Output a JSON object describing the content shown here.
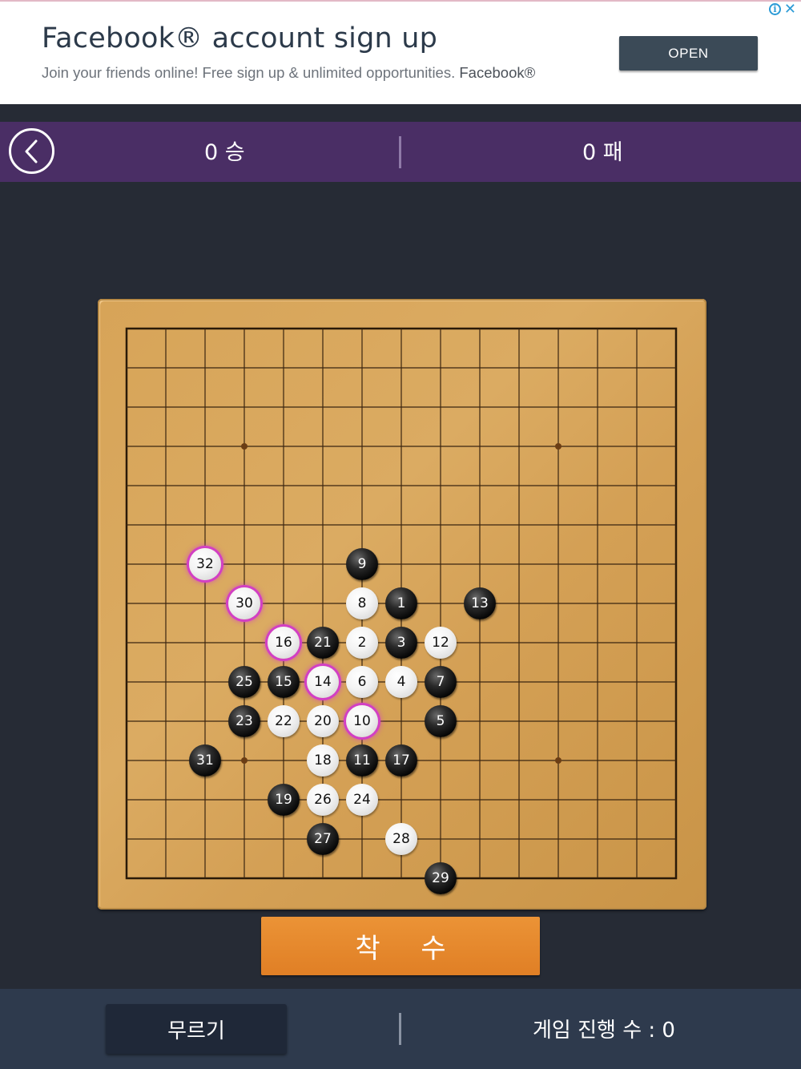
{
  "ad": {
    "title": "Facebook® account sign up",
    "subtitle": "Join your friends online! Free sign up & unlimited opportunities.",
    "brand": "Facebook®",
    "open_label": "OPEN",
    "info_icon": "info-icon",
    "close_icon": "close-icon",
    "accent_color": "#2a9ad6"
  },
  "scorebar": {
    "wins": "0 승",
    "losses": "0 패",
    "back_icon": "chevron-left-icon",
    "color": "#4a2e65"
  },
  "board": {
    "size": 15,
    "star_points": [
      [
        3,
        3
      ],
      [
        11,
        3
      ],
      [
        3,
        11
      ],
      [
        11,
        11
      ]
    ],
    "stones": [
      {
        "n": "1",
        "c": "black",
        "col": 7,
        "row": 7
      },
      {
        "n": "2",
        "c": "white",
        "col": 6,
        "row": 8
      },
      {
        "n": "3",
        "c": "black",
        "col": 7,
        "row": 8
      },
      {
        "n": "4",
        "c": "white",
        "col": 7,
        "row": 9
      },
      {
        "n": "5",
        "c": "black",
        "col": 8,
        "row": 10
      },
      {
        "n": "6",
        "c": "white",
        "col": 6,
        "row": 9
      },
      {
        "n": "7",
        "c": "black",
        "col": 8,
        "row": 9
      },
      {
        "n": "8",
        "c": "white",
        "col": 6,
        "row": 7
      },
      {
        "n": "9",
        "c": "black",
        "col": 6,
        "row": 6
      },
      {
        "n": "10",
        "c": "white",
        "col": 6,
        "row": 10,
        "mark": true
      },
      {
        "n": "11",
        "c": "black",
        "col": 6,
        "row": 11
      },
      {
        "n": "12",
        "c": "white",
        "col": 8,
        "row": 8
      },
      {
        "n": "13",
        "c": "black",
        "col": 9,
        "row": 7
      },
      {
        "n": "14",
        "c": "white",
        "col": 5,
        "row": 9,
        "mark": true
      },
      {
        "n": "15",
        "c": "black",
        "col": 4,
        "row": 9
      },
      {
        "n": "16",
        "c": "white",
        "col": 4,
        "row": 8,
        "mark": true
      },
      {
        "n": "17",
        "c": "black",
        "col": 7,
        "row": 11
      },
      {
        "n": "18",
        "c": "white",
        "col": 5,
        "row": 11
      },
      {
        "n": "19",
        "c": "black",
        "col": 4,
        "row": 12
      },
      {
        "n": "20",
        "c": "white",
        "col": 5,
        "row": 10
      },
      {
        "n": "21",
        "c": "black",
        "col": 5,
        "row": 8
      },
      {
        "n": "22",
        "c": "white",
        "col": 4,
        "row": 10
      },
      {
        "n": "23",
        "c": "black",
        "col": 3,
        "row": 10
      },
      {
        "n": "24",
        "c": "white",
        "col": 6,
        "row": 12
      },
      {
        "n": "25",
        "c": "black",
        "col": 3,
        "row": 9
      },
      {
        "n": "26",
        "c": "white",
        "col": 5,
        "row": 12
      },
      {
        "n": "27",
        "c": "black",
        "col": 5,
        "row": 13
      },
      {
        "n": "28",
        "c": "white",
        "col": 7,
        "row": 13
      },
      {
        "n": "29",
        "c": "black",
        "col": 8,
        "row": 14
      },
      {
        "n": "30",
        "c": "white",
        "col": 3,
        "row": 7,
        "mark": true
      },
      {
        "n": "31",
        "c": "black",
        "col": 2,
        "row": 11
      },
      {
        "n": "32",
        "c": "white",
        "col": 2,
        "row": 6,
        "mark": true
      }
    ]
  },
  "actions": {
    "place_label": "착 수",
    "undo_label": "무르기",
    "moves_label": "게임 진행 수 : 0",
    "place_color": "#e88a30"
  }
}
